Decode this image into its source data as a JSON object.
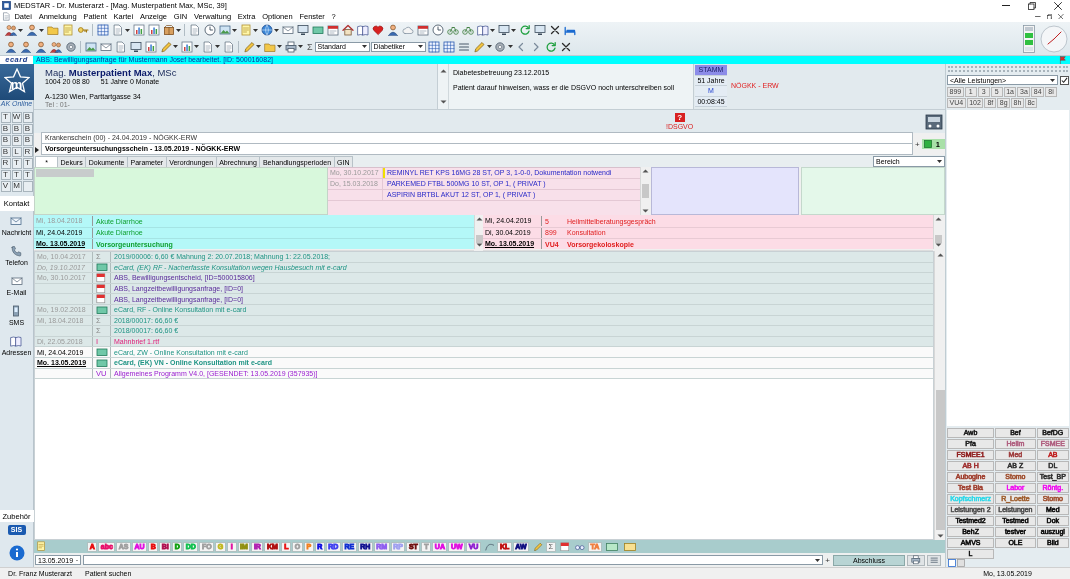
{
  "window": {
    "title": "MEDSTAR - Dr. Musterarzt - [Mag. Musterpatient Max, MSc, 39]"
  },
  "menu": [
    "Datei",
    "Anmeldung",
    "Patient",
    "Kartei",
    "Anzeige",
    "GIN",
    "Verwaltung",
    "Extra",
    "Optionen",
    "Fenster",
    "?"
  ],
  "toolbar": {
    "symbol": "Σ",
    "views": [
      "Standard",
      "Diabetiker"
    ]
  },
  "notice_bar": {
    "logo": "ecard",
    "message": "ABS: Bewilligungsanfrage für Mustermann Josef bearbeitet. [ID: 500016082]"
  },
  "sidebar": {
    "logo_letter": "m",
    "status": "AK Online",
    "keys": [
      "T",
      "W",
      "B",
      "B",
      "B",
      "B",
      "B",
      "B",
      "B",
      "B",
      "L",
      "R",
      "R",
      "T",
      "T",
      "T",
      "T",
      "T",
      "V",
      "M"
    ],
    "contact_header": "Kontakt",
    "actions": [
      {
        "label": "Nachricht",
        "kind": "message"
      },
      {
        "label": "Telefon",
        "kind": "phone"
      },
      {
        "label": "E-Mail",
        "kind": "email"
      },
      {
        "label": "SMS",
        "kind": "sms"
      },
      {
        "label": "Adressen",
        "kind": "address"
      }
    ],
    "accessories_header": "Zubehör",
    "accessories_logo": "SIS"
  },
  "patient": {
    "name": "Mag. **Musterpatient Max**, MSc",
    "number": "1004 20 08 80",
    "age": "51 Jahre 0 Monate",
    "address": "A-1230 Wien, Parttartgasse 34",
    "phone": "Tel : 01-"
  },
  "notes": [
    "Diabetesbetreuung 23.12.2015",
    "Patient darauf hinweisen, wass er die DSGVO noch unterschreiben soll"
  ],
  "master": {
    "title": "STAMM",
    "age": "51 Jahre",
    "sex": "M",
    "timer": "00:08:45",
    "insurance": "NÖGKK - ERW"
  },
  "consent_warning": {
    "symbol": "?",
    "label": "!DSGVO"
  },
  "vouchers": {
    "items": [
      {
        "text": "Krankenschein (00) - 24.04.2019 - NÖGKK-ERW",
        "selected": false
      },
      {
        "text": "Vorsorgeuntersuchungsschein - 13.05.2019 - NÖGKK-ERW",
        "selected": true
      }
    ],
    "add": "+",
    "count": "1"
  },
  "tabs": [
    {
      "label": "*",
      "selected": true
    },
    {
      "label": "Dekurs",
      "selected": false
    },
    {
      "label": "Dokumente",
      "selected": false
    },
    {
      "label": "Parameter",
      "selected": false
    },
    {
      "label": "Verordnungen",
      "selected": false
    },
    {
      "label": "Abrechnung",
      "selected": false
    },
    {
      "label": "Behandlungsperioden",
      "selected": false
    },
    {
      "label": "GIN",
      "selected": false
    }
  ],
  "area_select": {
    "value": "Bereich"
  },
  "medications": [
    {
      "date": "Mo, 30.10.2017",
      "text": "REMINYL RET KPS 16MG 28 ST, OP 3, 1-0-0, Dokumentation notwendi",
      "flagged": true
    },
    {
      "date": "Do, 15.03.2018",
      "text": "PARKEMED FTBL 500MG 10 ST, OP 1, ( PRIVAT )",
      "flagged": false
    },
    {
      "text": "ASPIRIN BRTBL AKUT 12 ST, OP 1, ( PRIVAT )",
      "flagged": false
    }
  ],
  "diagnoses": [
    {
      "date": "Mi, 18.04.2018",
      "text": "Akute Diarrhoe",
      "past": true,
      "today": false
    },
    {
      "date": "Mi, 24.04.2019",
      "text": "Akute Diarrhoe",
      "past": false,
      "today": false
    },
    {
      "date": "Mo. 13.05.2019",
      "text": "Vorsorgeuntersuchung",
      "past": false,
      "today": true
    }
  ],
  "services": [
    {
      "date": "Mi, 24.04.2019",
      "code": "5",
      "text": "Heilmittelberatungsgespräch",
      "today": false
    },
    {
      "date": "Di, 30.04.2019",
      "code": "899",
      "text": "Konsultation",
      "today": false
    },
    {
      "date": "Mo. 13.05.2019",
      "code": "VU4",
      "text": "Vorsorgekoloskopie",
      "today": true
    }
  ],
  "entries": [
    {
      "date": "Mo, 10.04.2017",
      "kind": "invoice",
      "symbol": "Σ",
      "text": "2019/00006: 6,60 € Mahnung 2: 20.07.2018; Mahnung 1: 22.05.2018;",
      "past": true,
      "today": false,
      "italic": false
    },
    {
      "date": "Do, 19.10.2017",
      "kind": "ecard",
      "text": "eCard, (EK) RF - Nacherfasste Konsultation wegen Hausbesuch mit e-card",
      "past": true,
      "today": false,
      "italic": true
    },
    {
      "date": "Mo, 30.10.2017",
      "kind": "gin",
      "text": "ABS, Bewilligungsentscheid, [ID=500015806]",
      "past": true,
      "today": false,
      "italic": false
    },
    {
      "kind": "gin",
      "text": "ABS, Langzeitbewilligungsanfrage, [ID=0]",
      "past": true,
      "today": false,
      "italic": false
    },
    {
      "kind": "gin",
      "text": "ABS, Langzeitbewilligungsanfrage, [ID=0]",
      "past": true,
      "today": false,
      "italic": false
    },
    {
      "date": "Mo, 19.02.2018",
      "kind": "ecard",
      "text": "eCard, RF - Online Konsultation mit e-card",
      "past": true,
      "today": false,
      "italic": false
    },
    {
      "date": "Mi, 18.04.2018",
      "kind": "invoice",
      "symbol": "Σ",
      "text": "2018/00017: 66,60 €",
      "past": true,
      "today": false,
      "italic": false
    },
    {
      "kind": "invoice",
      "symbol": "Σ",
      "text": "2018/00017: 66,60 €",
      "past": true,
      "today": false,
      "italic": false
    },
    {
      "date": "Di, 22.05.2018",
      "kind": "letter",
      "symbol": "I",
      "text": "Mahnbrief 1.rtf",
      "past": true,
      "today": false,
      "italic": false
    },
    {
      "date": "Mi, 24.04.2019",
      "kind": "ecard",
      "text": "eCard, ZW - Online Konsultation mit e-card",
      "past": false,
      "today": false,
      "italic": false
    },
    {
      "date": "Mo. 13.05.2019",
      "kind": "ecard",
      "text": "eCard, (EK) VN - Online Konsultation mit e-card",
      "past": false,
      "today": true,
      "italic": false
    },
    {
      "kind": "program",
      "symbol": "VU",
      "text": "Allgemeines Programm V4.0, [GESENDET: 13.05.2019 (357935)]",
      "past": false,
      "today": false,
      "italic": false
    }
  ],
  "code_bar": {
    "codes": [
      {
        "label": "A",
        "color": "#e81010"
      },
      {
        "label": "abc",
        "color": "#e8106a"
      },
      {
        "label": "AS",
        "color": "#a0a0a0"
      },
      {
        "label": "AU",
        "color": "#e010e0"
      },
      {
        "label": "B",
        "color": "#e81010"
      },
      {
        "label": "BI",
        "color": "#b01050"
      },
      {
        "label": "D",
        "color": "#10a010"
      },
      {
        "label": "DD",
        "color": "#10c050"
      },
      {
        "label": "FO",
        "color": "#a0a0a0"
      },
      {
        "label": "G",
        "color": "#c0b820"
      },
      {
        "label": "I",
        "color": "#e010a0"
      },
      {
        "label": "IM",
        "color": "#909010"
      },
      {
        "label": "IR",
        "color": "#b020b0"
      },
      {
        "label": "KM",
        "color": "#b01010"
      },
      {
        "label": "L",
        "color": "#e81010"
      },
      {
        "label": "O",
        "color": "#a0a0a0"
      },
      {
        "label": "P",
        "color": "#f08020"
      },
      {
        "label": "R",
        "color": "#1010e0"
      },
      {
        "label": "RD",
        "color": "#4040f0"
      },
      {
        "label": "RE",
        "color": "#1030d0"
      },
      {
        "label": "RH",
        "color": "#101090"
      },
      {
        "label": "RM",
        "color": "#9060f0"
      },
      {
        "label": "RP",
        "color": "#a0a0f0"
      },
      {
        "label": "ST",
        "color": "#701010"
      },
      {
        "label": "T",
        "color": "#a0a0a0"
      },
      {
        "label": "UA",
        "color": "#e010e0"
      },
      {
        "label": "UW",
        "color": "#e010e0"
      },
      {
        "label": "VU",
        "color": "#9020d0"
      }
    ],
    "codes_2": [
      {
        "label": "KL",
        "color": "#c01010"
      },
      {
        "label": "AW",
        "color": "#101080"
      }
    ],
    "symbol": "Σ",
    "codes_3": [
      {
        "label": "TA",
        "color": "#f08040"
      }
    ]
  },
  "entry_bar": {
    "date": "13.05.2019",
    "add": "+",
    "finish": "Abschluss"
  },
  "right_panel": {
    "filter": "<Alle Leistungen>",
    "filter_checked": true,
    "codes": [
      "899",
      "1",
      "3",
      "5",
      "1a",
      "3a",
      "84",
      "8i",
      "VU4",
      "102",
      "8f",
      "8g",
      "8h",
      "8c"
    ],
    "shortcuts": [
      {
        "label": "Awb",
        "color": "#202020"
      },
      {
        "label": "Bef",
        "color": "#202020"
      },
      {
        "label": "BefDG",
        "color": "#202020"
      },
      {
        "label": "Pfa",
        "color": "#202020"
      },
      {
        "label": "Heilm",
        "color": "#b06080"
      },
      {
        "label": "FSMEE",
        "color": "#b06080"
      },
      {
        "label": "FSMEE1",
        "color": "#902020"
      },
      {
        "label": "Med",
        "color": "#a04040"
      },
      {
        "label": "AB",
        "color": "#c02020"
      },
      {
        "label": "AB H",
        "color": "#a03030"
      },
      {
        "label": "AB Z",
        "color": "#303030"
      },
      {
        "label": "DL",
        "color": "#303030"
      },
      {
        "label": "Aubogine",
        "color": "#a04030"
      },
      {
        "label": "Stomo",
        "color": "#a05030"
      },
      {
        "label": "Test_BP",
        "color": "#303030"
      },
      {
        "label": "Test Bla",
        "color": "#a04030"
      },
      {
        "label": "Labor",
        "color": "#f010f0"
      },
      {
        "label": "Röntg.",
        "color": "#f010f0"
      },
      {
        "label": "Kopfschmerz",
        "color": "#30d8e8"
      },
      {
        "label": "R_Loette",
        "color": "#a06030"
      },
      {
        "label": "Stomo",
        "color": "#a05030"
      },
      {
        "label": "Leistungen 2",
        "color": "#505050"
      },
      {
        "label": "Leistungen",
        "color": "#505050"
      },
      {
        "label": "Med",
        "color": "#101010"
      },
      {
        "label": "Testmed2",
        "color": "#101010"
      },
      {
        "label": "Testmed",
        "color": "#101010"
      },
      {
        "label": "Dok",
        "color": "#101010"
      },
      {
        "label": "BehZ",
        "color": "#101010"
      },
      {
        "label": "testver",
        "color": "#101010"
      },
      {
        "label": "auszugl",
        "color": "#101010"
      },
      {
        "label": "AMVS",
        "color": "#101010"
      },
      {
        "label": "OLE",
        "color": "#101010"
      },
      {
        "label": "Bild",
        "color": "#101010"
      },
      {
        "label": "L",
        "color": "#101010"
      }
    ]
  },
  "status_bar": {
    "user": "Dr. Franz Musterarzt",
    "hint": "Patient suchen",
    "date": "Mo, 13.05.2019"
  }
}
